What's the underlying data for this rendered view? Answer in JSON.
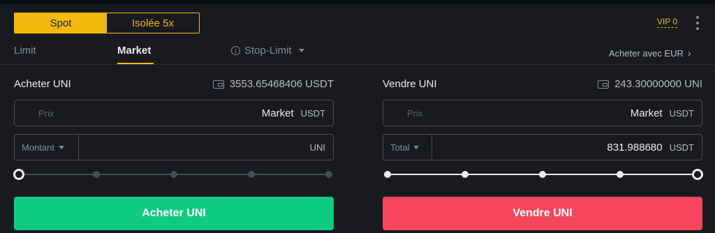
{
  "mode_toggle": {
    "spot": "Spot",
    "isolated": "Isolée 5x"
  },
  "vip": "VIP 0",
  "tabs": {
    "limit": "Limit",
    "market": "Market",
    "stop_limit": "Stop-Limit"
  },
  "buy_with": "Acheter avec EUR",
  "buy": {
    "title": "Acheter UNI",
    "balance": "3553.65468406 USDT",
    "price_label": "Prix",
    "price_value": "Market",
    "price_unit": "USDT",
    "amount_select": "Montant",
    "amount_value": "",
    "amount_unit": "UNI",
    "slider_percent": 0,
    "button": "Acheter UNI"
  },
  "sell": {
    "title": "Vendre UNI",
    "balance": "243.30000000 UNI",
    "price_label": "Prix",
    "price_value": "Market",
    "price_unit": "USDT",
    "total_select": "Total",
    "total_value": "831.988680",
    "total_unit": "USDT",
    "slider_percent": 100,
    "button": "Vendre UNI"
  },
  "colors": {
    "accent": "#f0b90b",
    "buy": "#0ecb81",
    "sell": "#f6465d",
    "background": "#181a20"
  }
}
